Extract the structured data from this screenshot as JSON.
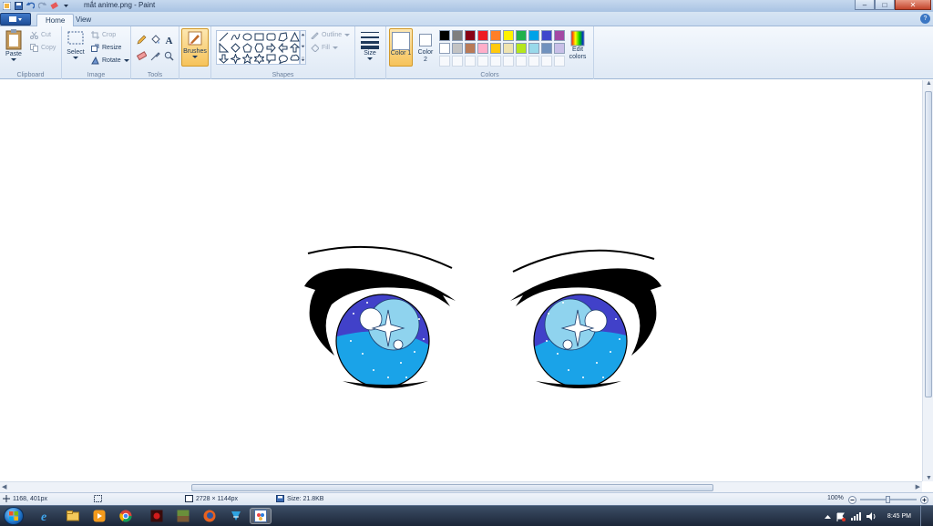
{
  "window": {
    "title": "mắt anime.png - Paint",
    "controls": [
      "–",
      "□",
      "✕"
    ]
  },
  "tabs": [
    "Home",
    "View"
  ],
  "ribbon": {
    "clipboard": {
      "label": "Clipboard",
      "paste": "Paste",
      "cut": "Cut",
      "copy": "Copy"
    },
    "image": {
      "label": "Image",
      "select": "Select",
      "crop": "Crop",
      "resize": "Resize",
      "rotate": "Rotate"
    },
    "tools": {
      "label": "Tools"
    },
    "brushes": {
      "label": "Brushes"
    },
    "shapes": {
      "label": "Shapes",
      "outline": "Outline",
      "fill": "Fill"
    },
    "size": {
      "label": "Size"
    },
    "colors": {
      "label": "Colors",
      "color1": "Color 1",
      "color2": "Color 2",
      "edit": "Edit colors",
      "palette_row1": [
        "#000000",
        "#7f7f7f",
        "#880015",
        "#ed1c24",
        "#ff7f27",
        "#fff200",
        "#22b14c",
        "#00a2e8",
        "#3f48cc",
        "#a349a4"
      ],
      "palette_row2": [
        "#ffffff",
        "#c3c3c3",
        "#b97a57",
        "#ffaec9",
        "#ffc90e",
        "#efe4b0",
        "#b5e61d",
        "#99d9ea",
        "#7092be",
        "#c8bfe7"
      ]
    }
  },
  "statusbar": {
    "cursor_pos": "1168, 401px",
    "dimensions": "2728 × 1144px",
    "size": "Size: 21.8KB",
    "zoom": "100%"
  },
  "taskbar": {
    "clock": "8:45 PM"
  },
  "colors": {
    "iris_top": "#4141c9",
    "iris_bottom": "#1aa3e8",
    "highlight": "#8fd3ee",
    "accent": "#f5a623"
  }
}
